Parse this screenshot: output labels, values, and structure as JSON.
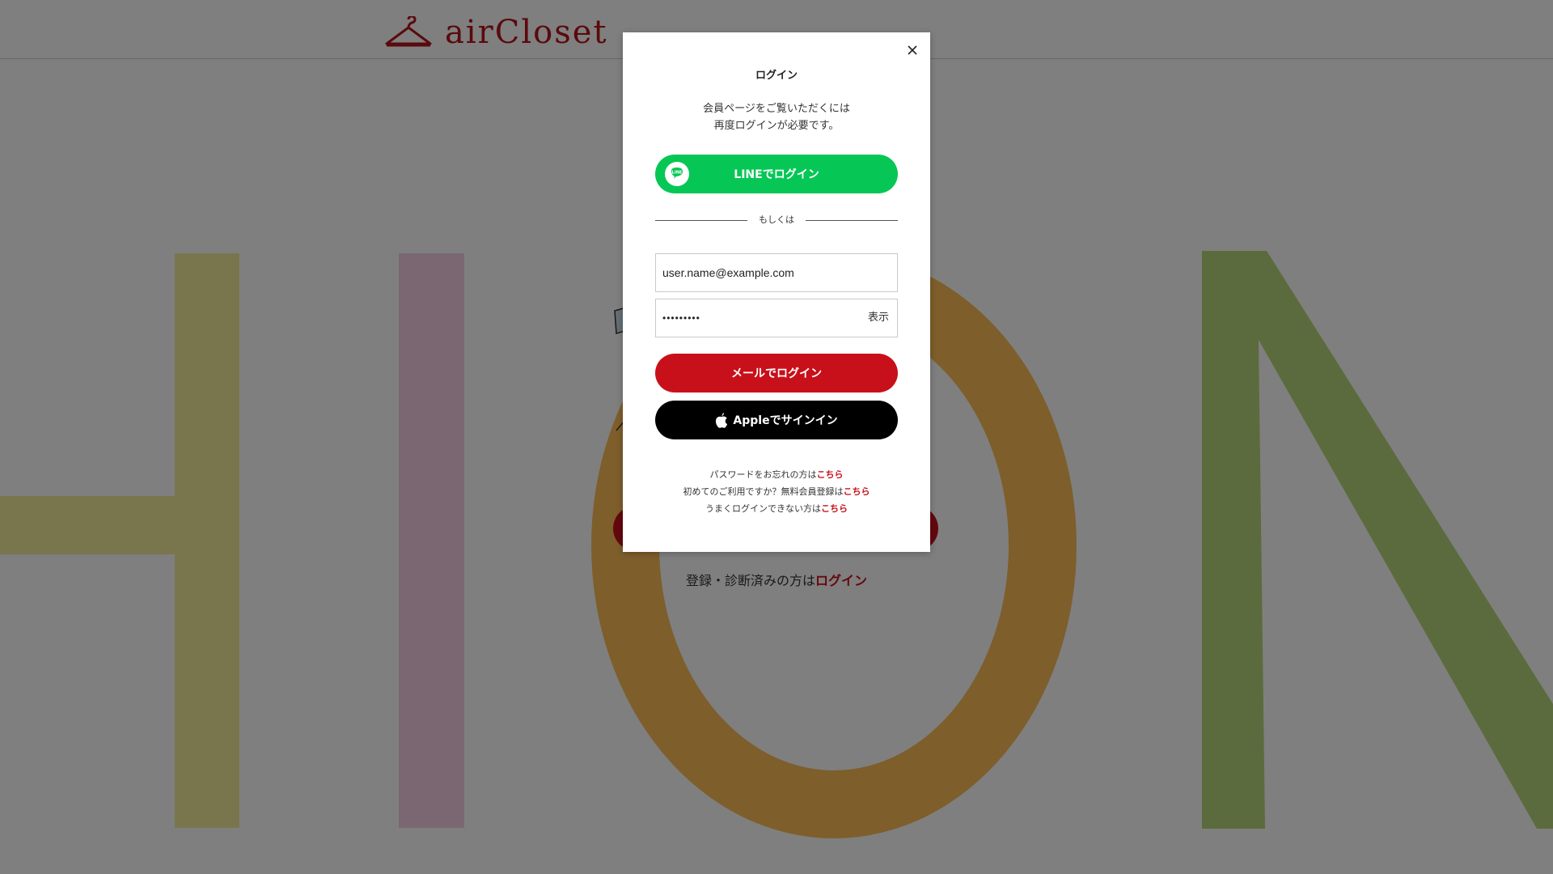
{
  "header": {
    "logo_text": "airCloset"
  },
  "background": {
    "login_hint_prefix": "登録・診断済みの方は",
    "login_hint_link": "ログイン"
  },
  "modal": {
    "title": "ログイン",
    "desc_line1": "会員ページをご覧いただくには",
    "desc_line2": "再度ログインが必要です。",
    "line_button": "LINEでログイン",
    "line_icon_text": "LINE",
    "divider_text": "もしくは",
    "email_value": "user.name@example.com",
    "password_value": "•••••••••",
    "show_password": "表示",
    "mail_button": "メールでログイン",
    "apple_button": "Appleでサインイン",
    "forgot_prefix": "パスワードをお忘れの方は",
    "forgot_link": "こちら",
    "first_prefix": "初めてのご利用ですか？無料会員登録は",
    "first_link": "こちら",
    "trouble_prefix": "うまくログインできない方は",
    "trouble_link": "こちら"
  },
  "colors": {
    "brand_red": "#c8101a",
    "line_green": "#06c755",
    "apple_black": "#000000",
    "overlay": "rgba(0,0,0,0.5)"
  },
  "icons": [
    "hanger-icon",
    "close-icon",
    "line-logo-icon",
    "apple-icon"
  ]
}
